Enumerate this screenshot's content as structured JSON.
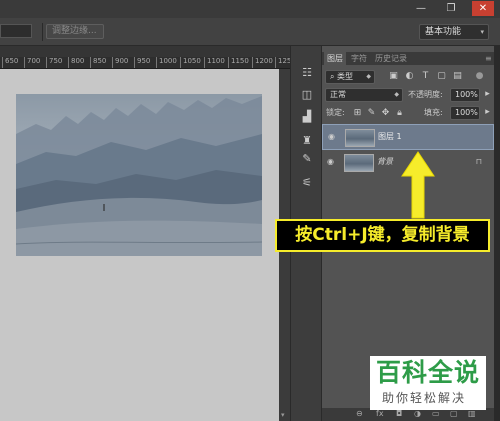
{
  "optionsbar": {
    "adjust_label": "调整边缘...",
    "workspace": "基本功能"
  },
  "ruler": {
    "ticks": [
      "650",
      "700",
      "750",
      "800",
      "850",
      "900",
      "950",
      "1000",
      "1050",
      "1100",
      "1150",
      "1200",
      "1250"
    ]
  },
  "layers_panel": {
    "tabs": [
      "图层",
      "字符",
      "历史记录"
    ],
    "filter_kind": "类型",
    "blend_mode": "正常",
    "opacity_label": "不透明度:",
    "opacity_value": "100%",
    "lock_label": "锁定:",
    "fill_label": "填充:",
    "fill_value": "100%",
    "layers": [
      {
        "name": "图层 1",
        "selected": true
      },
      {
        "name": "背景",
        "selected": false,
        "locked": true
      }
    ]
  },
  "annotation": {
    "text": "按Ctrl+J键，复制背景"
  },
  "watermark": {
    "title": "百科全说",
    "subtitle": "助你轻松解决"
  },
  "colors": {
    "callout": "#f6ec2b",
    "selection": "#6d7a8c",
    "watermark_green": "#2e9c48"
  }
}
